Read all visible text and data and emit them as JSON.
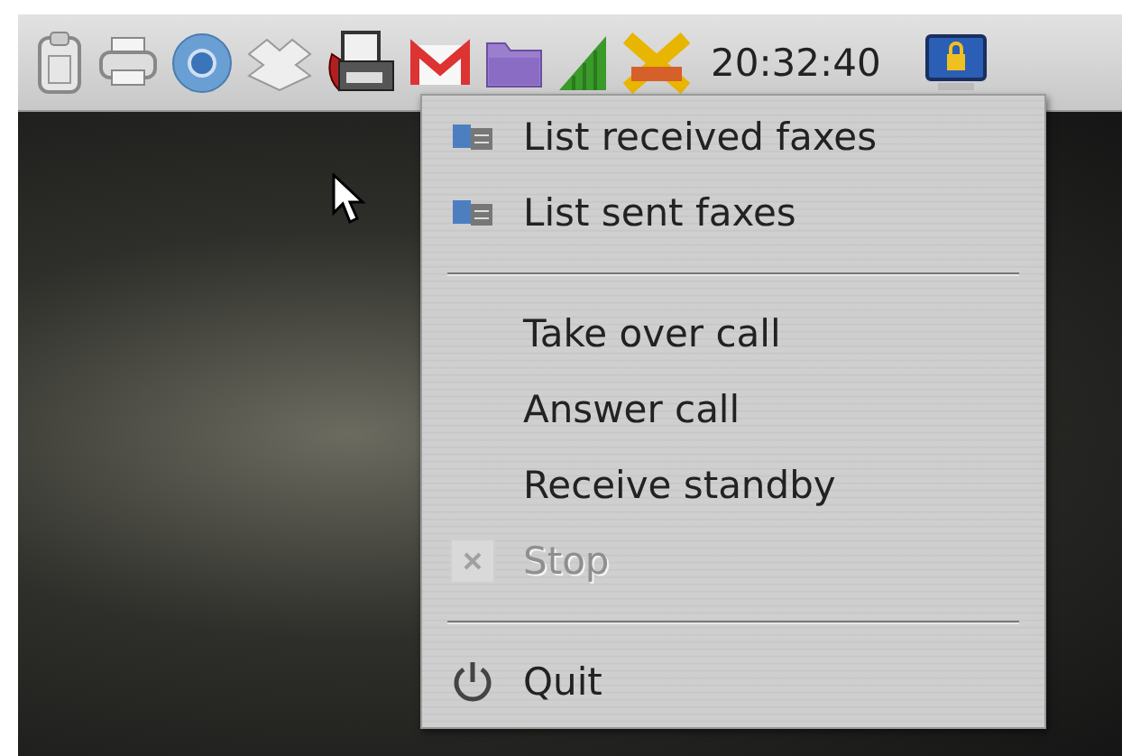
{
  "panel": {
    "clock": "20:32:40"
  },
  "menu": {
    "items": [
      {
        "kind": "list",
        "label": "List received faxes",
        "disabled": false
      },
      {
        "kind": "list",
        "label": "List sent faxes",
        "disabled": false
      },
      {
        "kind": "separator"
      },
      {
        "kind": "plain",
        "label": "Take over call",
        "disabled": false
      },
      {
        "kind": "plain",
        "label": "Answer call",
        "disabled": false
      },
      {
        "kind": "plain",
        "label": "Receive standby",
        "disabled": false
      },
      {
        "kind": "stop",
        "label": "Stop",
        "disabled": true
      },
      {
        "kind": "separator"
      },
      {
        "kind": "quit",
        "label": "Quit",
        "disabled": false
      }
    ]
  }
}
